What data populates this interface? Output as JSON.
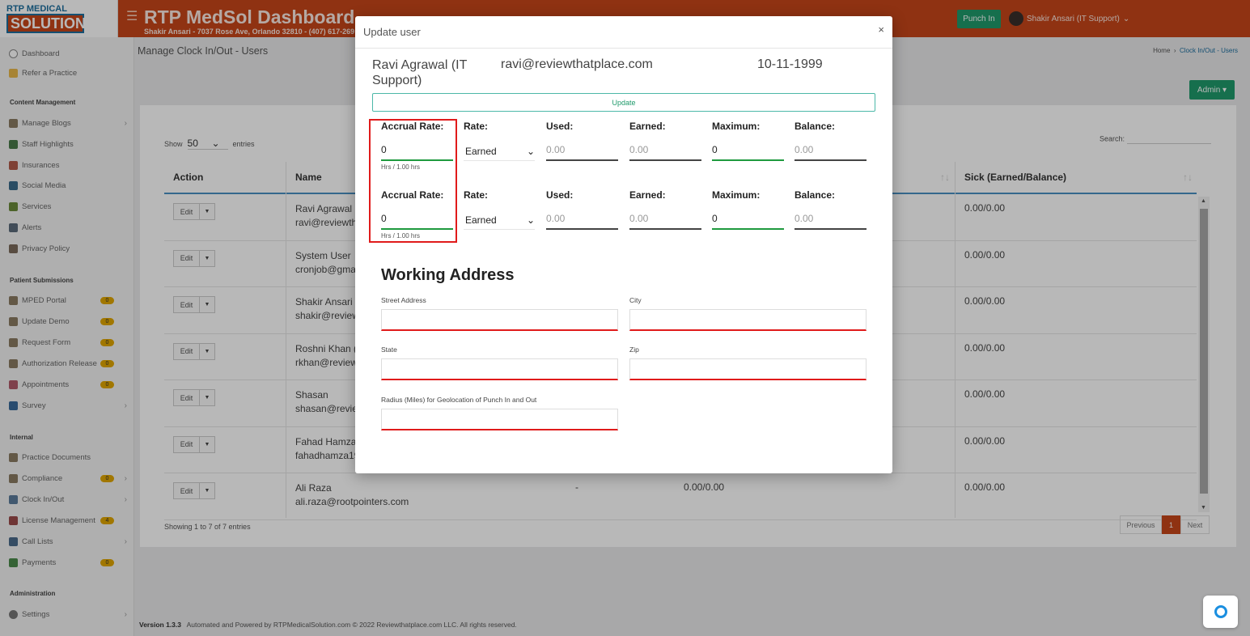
{
  "header": {
    "logo_line1": "RTP MEDICAL",
    "logo_line2": "SOLUTION",
    "title": "RTP MedSol Dashboard",
    "subtitle": "Shakir Ansari - 7037 Rose Ave, Orlando 32810 - (407) 617-269",
    "punch_in": "Punch In",
    "user": "Shakir Ansari (IT Support)"
  },
  "sidebar": {
    "items": [
      {
        "label": "Dashboard"
      },
      {
        "label": "Refer a Practice"
      },
      {
        "label": "Manage Blogs"
      },
      {
        "label": "Staff Highlights"
      },
      {
        "label": "Insurances"
      },
      {
        "label": "Social Media"
      },
      {
        "label": "Services"
      },
      {
        "label": "Alerts"
      },
      {
        "label": "Privacy Policy"
      },
      {
        "label": "MPED Portal",
        "badge": "0"
      },
      {
        "label": "Update Demo",
        "badge": "0"
      },
      {
        "label": "Request Form",
        "badge": "0"
      },
      {
        "label": "Authorization Release",
        "badge": "0"
      },
      {
        "label": "Appointments",
        "badge": "0"
      },
      {
        "label": "Survey"
      },
      {
        "label": "Practice Documents"
      },
      {
        "label": "Compliance",
        "badge": "0"
      },
      {
        "label": "Clock In/Out"
      },
      {
        "label": "License Management",
        "badge": "4"
      },
      {
        "label": "Call Lists"
      },
      {
        "label": "Payments",
        "badge": "0"
      },
      {
        "label": "Settings"
      }
    ],
    "sections": [
      "Content Management",
      "Patient Submissions",
      "Internal",
      "Administration"
    ]
  },
  "page": {
    "title": "Manage Clock In/Out - Users",
    "breadcrumb_home": "Home",
    "breadcrumb_current": "Clock In/Out - Users",
    "admin_button": "Admin",
    "show_label": "Show",
    "show_value": "50",
    "entries_label": "entries",
    "search_label": "Search:",
    "showing": "Showing 1 to 7 of 7 entries",
    "prev": "Previous",
    "page_num": "1",
    "next": "Next",
    "footer_version": "Version 1.3.3",
    "footer_text": "Automated and Powered by RTPMedicalSolution.com © 2022 Reviewthatplace.com LLC. All rights reserved."
  },
  "table": {
    "headers": [
      "Action",
      "Name",
      "Sick (Earned/Balance)"
    ],
    "edit_label": "Edit",
    "rows": [
      {
        "name": "Ravi Agrawal (",
        "email": "ravi@reviewtha",
        "c3": "",
        "c4": "",
        "sick": "0.00/0.00"
      },
      {
        "name": "System User",
        "email": "cronjob@gmai",
        "c3": "",
        "c4": "",
        "sick": "0.00/0.00"
      },
      {
        "name": "Shakir Ansari (",
        "email": "shakir@review",
        "c3": "",
        "c4": "",
        "sick": "0.00/0.00"
      },
      {
        "name": "Roshni Khan (I",
        "email": "rkhan@reviewt",
        "c3": "",
        "c4": "",
        "sick": "0.00/0.00"
      },
      {
        "name": "Shasan",
        "email": "shasan@revie",
        "c3": "",
        "c4": "",
        "sick": "0.00/0.00"
      },
      {
        "name": "Fahad Hamza",
        "email": "fahadhamza19",
        "c3": "",
        "c4": "",
        "sick": "0.00/0.00"
      },
      {
        "name": "Ali Raza",
        "email": "ali.raza@rootpointers.com",
        "c3": "-",
        "c4": "0.00/0.00",
        "sick": "0.00/0.00"
      }
    ]
  },
  "modal": {
    "title": "Update user",
    "close": "×",
    "user_name": "Ravi Agrawal (IT Support)",
    "user_email": "ravi@reviewthatplace.com",
    "user_dob": "10-11-1999",
    "update_button": "Update",
    "labels": {
      "accrual_rate": "Accrual Rate:",
      "rate": "Rate:",
      "used": "Used:",
      "earned": "Earned:",
      "maximum": "Maximum:",
      "balance": "Balance:"
    },
    "rows": [
      {
        "accrual": "0",
        "hint": "Hrs / 1.00 hrs",
        "rate": "Earned",
        "used": "0.00",
        "earned": "0.00",
        "maximum": "0",
        "balance": "0.00"
      },
      {
        "accrual": "0",
        "hint": "Hrs / 1.00 hrs",
        "rate": "Earned",
        "used": "0.00",
        "earned": "0.00",
        "maximum": "0",
        "balance": "0.00"
      }
    ],
    "working_address": "Working Address",
    "street_label": "Street Address",
    "city_label": "City",
    "state_label": "State",
    "zip_label": "Zip",
    "radius_label": "Radius (Miles) for Geolocation of Punch In and Out"
  },
  "colors": {
    "brand": "#c6461a",
    "accent_green": "#1f9a6b",
    "highlight_red": "#e01b1b"
  }
}
